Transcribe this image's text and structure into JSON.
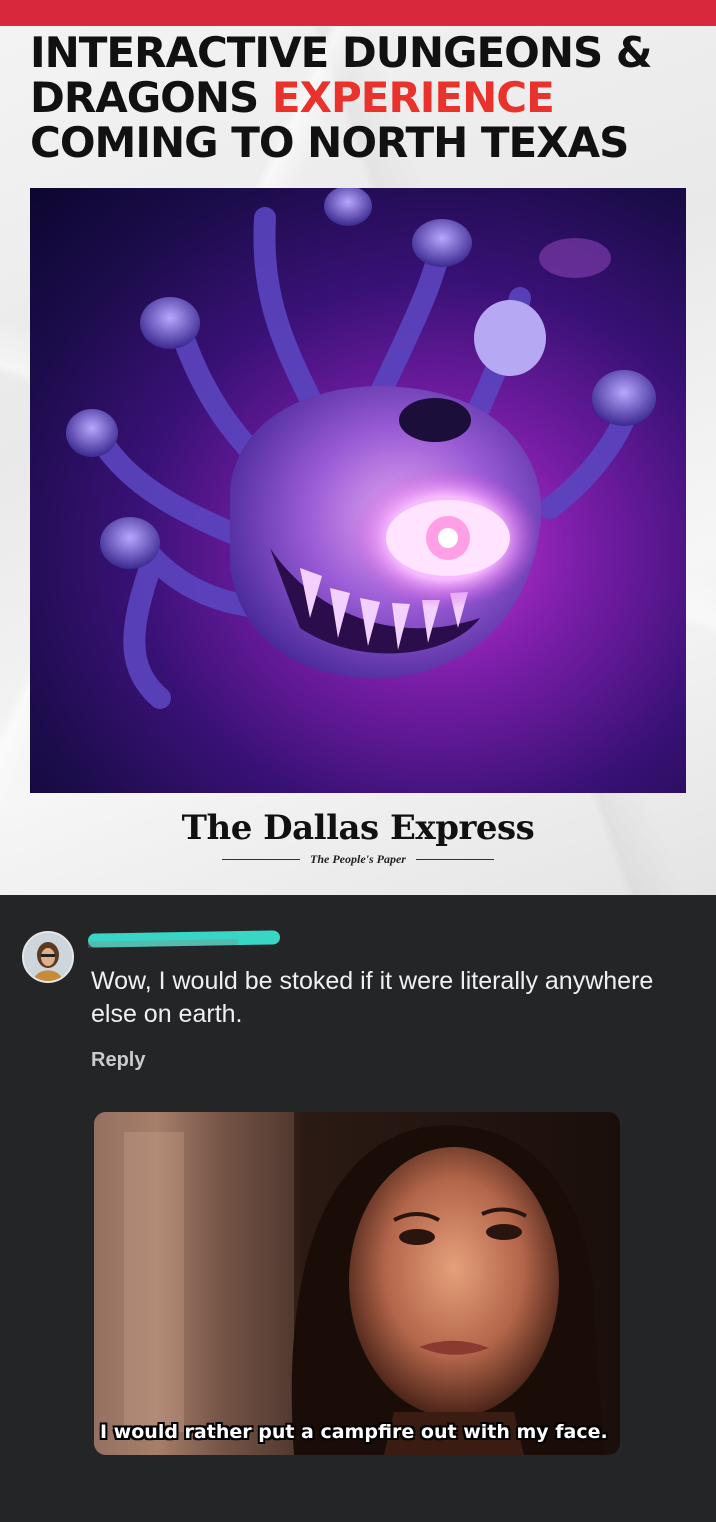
{
  "article": {
    "headline_part1": "INTERACTIVE DUNGEONS & DRAGONS ",
    "headline_highlight": "EXPERIENCE",
    "headline_part2": " COMING TO NORTH TEXAS",
    "accent_color": "#d8283c",
    "highlight_color": "#e8322b",
    "publisher": "The Dallas Express",
    "tagline": "The People's Paper"
  },
  "comment": {
    "author_name_redacted": true,
    "text": "Wow, I would be stoked if it were literally anywhere else on earth.",
    "reply_label": "Reply",
    "gif_caption": "I would rather put a campfire out with my face."
  },
  "colors": {
    "comment_bg": "#232527",
    "redaction": "#38d6c4"
  }
}
